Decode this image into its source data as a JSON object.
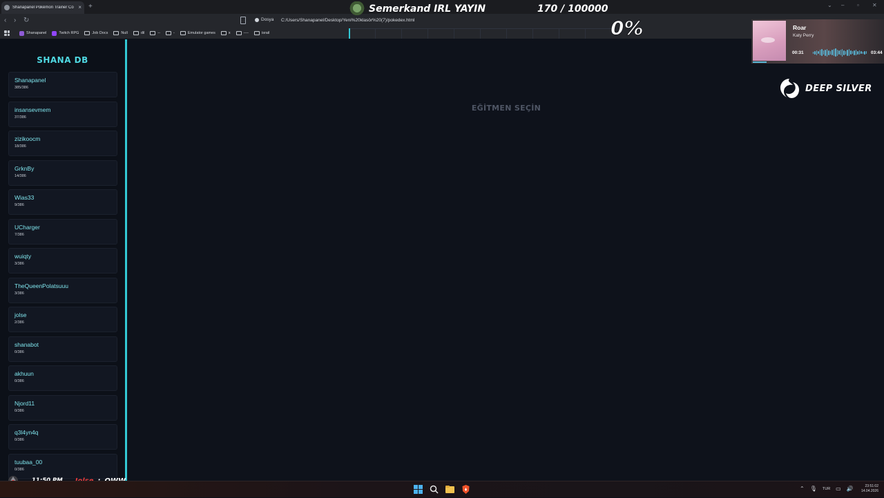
{
  "browser": {
    "tab_title": "Shanapanel Pokémon Trainer Co",
    "tab_close": "×",
    "new_tab": "+",
    "site_info_label": "Dosya",
    "url": "C:/Users/Shanapanel/Desktop/Yeni%20klasör%20(7)/pokedex.html",
    "bookmarks": [
      "Shanapanel",
      "Twitch RPG",
      "Job Docs",
      "Null",
      "dil",
      "--",
      "-",
      "Emulator games",
      "x",
      "----",
      "israil"
    ]
  },
  "sidebar": {
    "title": "SHANA DB",
    "players": [
      {
        "name": "Shanapanel",
        "count": "385/386"
      },
      {
        "name": "insansevmem",
        "count": "37/386"
      },
      {
        "name": "zizikoocm",
        "count": "18/386"
      },
      {
        "name": "GrknBy",
        "count": "14/386"
      },
      {
        "name": "Wias33",
        "count": "9/386"
      },
      {
        "name": "UCharger",
        "count": "7/386"
      },
      {
        "name": "wuiqty",
        "count": "3/386"
      },
      {
        "name": "TheQueenPolatsuuu",
        "count": "3/386"
      },
      {
        "name": "jolse",
        "count": "2/386"
      },
      {
        "name": "shanabot",
        "count": "0/386"
      },
      {
        "name": "akhuun",
        "count": "0/386"
      },
      {
        "name": "Njord11",
        "count": "0/386"
      },
      {
        "name": "q3l4yn4q",
        "count": "0/386"
      },
      {
        "name": "tuubaa_00",
        "count": "0/386"
      }
    ]
  },
  "main": {
    "title": "EĞİTMEN SEÇİN"
  },
  "overlay": {
    "stream_title": "Semerkand IRL YAYIN",
    "goal": "170 / 100000",
    "goal_percent": "0%",
    "goal_fraction": 0.0017,
    "music": {
      "song": "Roar",
      "artist": "Katy Perry",
      "elapsed": "00:31",
      "total": "03:44"
    },
    "brand": "DEEP SILVER",
    "chat": {
      "time": "11:50 PM",
      "user": "Jolse",
      "separator": ":",
      "message": "OWW"
    }
  },
  "taskbar": {
    "language": "TUR",
    "time": "23:51:02",
    "date": "14.04.2026"
  },
  "colors": {
    "accent": "#32c8d4",
    "player_name": "#7fe4ec",
    "chat_user": "#e23b3b"
  }
}
